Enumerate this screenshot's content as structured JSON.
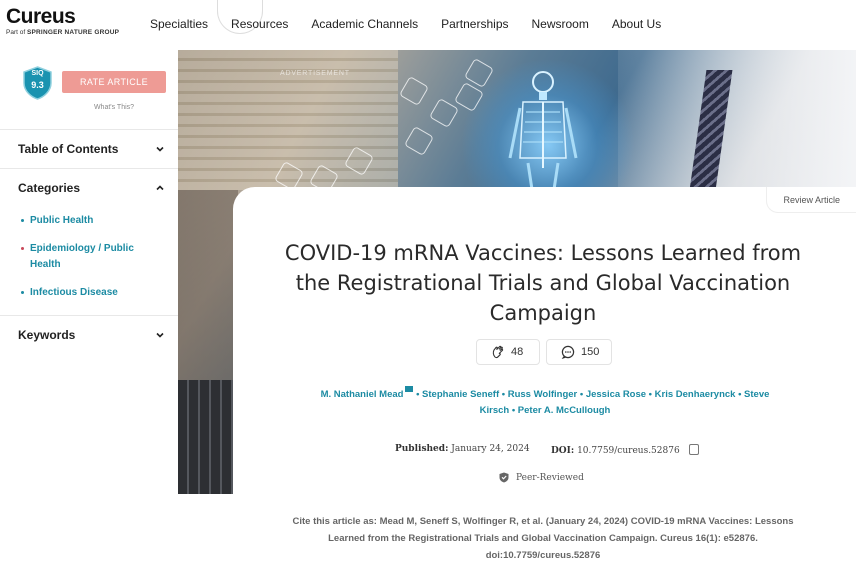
{
  "header": {
    "logo": "Cureus",
    "logo_sub_prefix": "Part of",
    "logo_sub_brand": "SPRINGER NATURE GROUP",
    "nav": [
      "Specialties",
      "Resources",
      "Academic Channels",
      "Partnerships",
      "Newsroom",
      "About Us"
    ]
  },
  "sidebar": {
    "siq_label": "SIQ",
    "siq_score": "9.3",
    "rate_button": "RATE ARTICLE",
    "whats_this": "What's This?",
    "toc_label": "Table of Contents",
    "categories_label": "Categories",
    "categories": [
      {
        "label": "Public Health"
      },
      {
        "label": "Epidemiology / Public Health"
      },
      {
        "label": "Infectious Disease"
      }
    ],
    "keywords_label": "Keywords"
  },
  "hero": {
    "advert": "ADVERTISEMENT"
  },
  "article": {
    "type": "Review Article",
    "title": "COVID-19 mRNA Vaccines: Lessons Learned from the Registrational Trials and Global Vaccination Campaign",
    "claps": "48",
    "comments": "150",
    "authors_line1": "M. Nathaniel Mead",
    "authors_line1_rest": " • Stephanie Seneff • Russ Wolfinger • Jessica Rose • Kris Denhaerynck • Steve",
    "authors_line2": "Kirsch • Peter A. McCullough",
    "published_label": "Published:",
    "published_date": "January 24, 2024",
    "doi_label": "DOI:",
    "doi_value": "10.7759/cureus.52876",
    "peer_reviewed": "Peer-Reviewed",
    "citation": "Cite this article as: Mead M, Seneff S, Wolfinger R, et al. (January 24, 2024) COVID-19 mRNA Vaccines: Lessons Learned from the Registrational Trials and Global Vaccination Campaign. Cureus 16(1): e52876. doi:10.7759/cureus.52876"
  },
  "colors": {
    "link": "#1c8ba3",
    "rate_button": "#ee9b95",
    "siq_badge": "#1a93b0"
  }
}
